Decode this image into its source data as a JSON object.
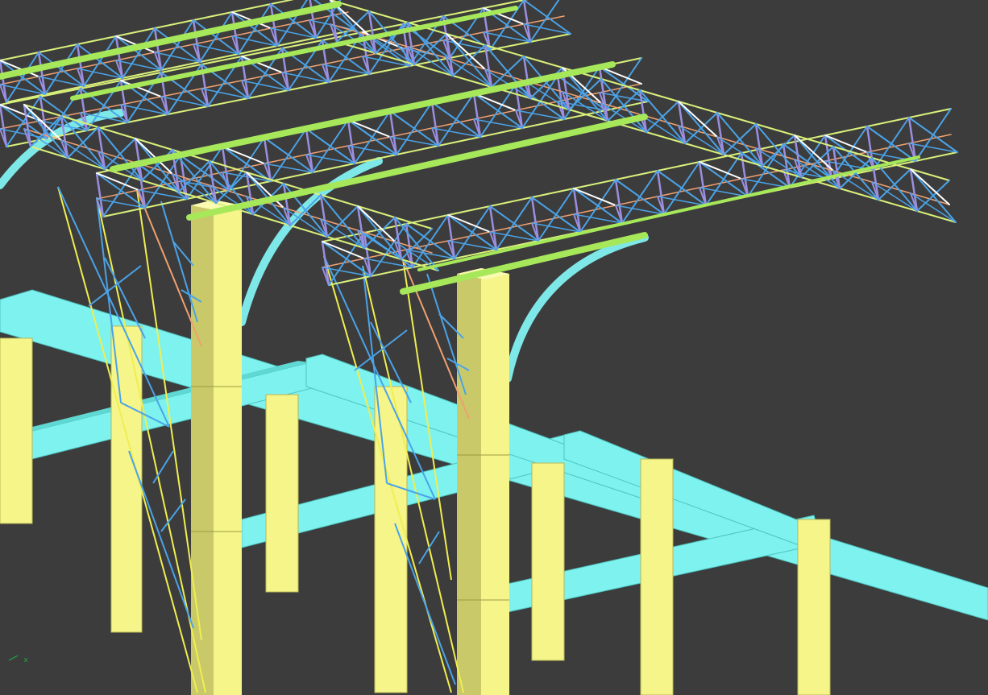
{
  "viewport": {
    "background": "#3c3c3c"
  },
  "colors": {
    "truss_diagonal": "#4aa3e8",
    "truss_vertical": "#9a8fe0",
    "truss_chord_top": "#d8f07a",
    "truss_chord_bottom": "#f0a070",
    "truss_highlight": "#ffffff",
    "ring_pipe": "#a6e85a",
    "arch": "#7ee8e8",
    "column": "#f5f58a",
    "column_shade": "#c9c96a",
    "beam": "#7ef2ee",
    "beam_shade": "#4fc4c0",
    "cable": "#f0ee50"
  },
  "axis_indicator": {
    "label": "x",
    "icon": "ucs-axis-icon"
  }
}
